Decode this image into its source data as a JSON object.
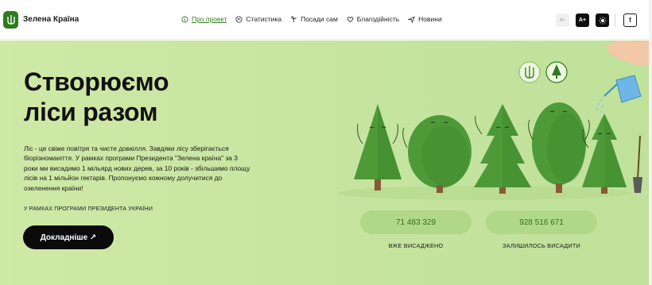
{
  "header": {
    "brand": "Зелена Країна",
    "nav": [
      {
        "label": "Про проект",
        "icon": "info-icon"
      },
      {
        "label": "Статистика",
        "icon": "chart-icon"
      },
      {
        "label": "Посади сам",
        "icon": "sprout-icon"
      },
      {
        "label": "Благодійність",
        "icon": "heart-icon"
      },
      {
        "label": "Новини",
        "icon": "send-icon"
      }
    ],
    "controls": {
      "font_decrease": "A-",
      "font_increase": "A+",
      "theme_icon": "sun-icon",
      "facebook": "f"
    }
  },
  "hero": {
    "title_line1": "Створюємо",
    "title_line2": "ліси разом",
    "description": "Ліс - це свіже повітря та чисте довкілля. Завдяки лісу зберігається біорізноманіття. У рамках програми Президента \"Зелена країна\" за 3 роки ми висадимо 1 мільярд нових дерев, за 10 років - збільшимо площу лісів на 1 мільйон гектарів. Пропонуємо кожному долучитися до озеленення країни!",
    "subtitle": "У РАМКАХ ПРОГРАМИ ПРЕЗИДЕНТА УКРАЇНИ",
    "button": "Докладніше ↗"
  },
  "stats": [
    {
      "value": "71 483 329",
      "label": "ВЖЕ ВИСАДЖЕНО"
    },
    {
      "value": "928 516 671",
      "label": "ЗАЛИШИЛОСЬ ВИСАДИТИ"
    }
  ],
  "colors": {
    "accent": "#2f7a1f",
    "hero_bg": "#c6e4a0",
    "stat_bg": "#b1d888",
    "tree_dark": "#3f8f2e",
    "tree_light": "#5aa53f"
  }
}
